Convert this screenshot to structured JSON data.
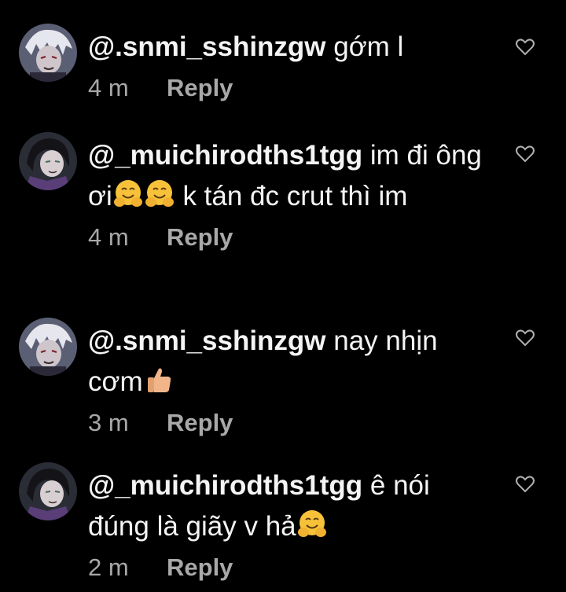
{
  "comments": [
    {
      "username": "@.snmi_sshinzgw",
      "text_parts": [
        " gớm l"
      ],
      "time": "4 m",
      "reply_label": "Reply",
      "avatar": "white-haired-character"
    },
    {
      "username": "@_muichirodths1tgg",
      "text_parts": [
        " im đi ông ơi",
        " k tán đc crut thì im"
      ],
      "emojis": [
        "hugging-face-emoji",
        "hugging-face-emoji"
      ],
      "time": "4 m",
      "reply_label": "Reply",
      "avatar": "dark-haired-character"
    },
    {
      "username": "@.snmi_sshinzgw",
      "text_parts": [
        " nay nhịn cơm"
      ],
      "emojis": [
        "thumbs-up-emoji"
      ],
      "time": "3 m",
      "reply_label": "Reply",
      "avatar": "white-haired-character"
    },
    {
      "username": "@_muichirodths1tgg",
      "text_parts": [
        " ê nói đúng là giãy v hả"
      ],
      "emojis": [
        "hugging-face-emoji"
      ],
      "time": "2 m",
      "reply_label": "Reply",
      "avatar": "dark-haired-character"
    }
  ],
  "colors": {
    "background": "#000000",
    "text": "#f4f4f4",
    "meta": "#a8a8a8",
    "heart_outline": "#b0b0b0"
  }
}
